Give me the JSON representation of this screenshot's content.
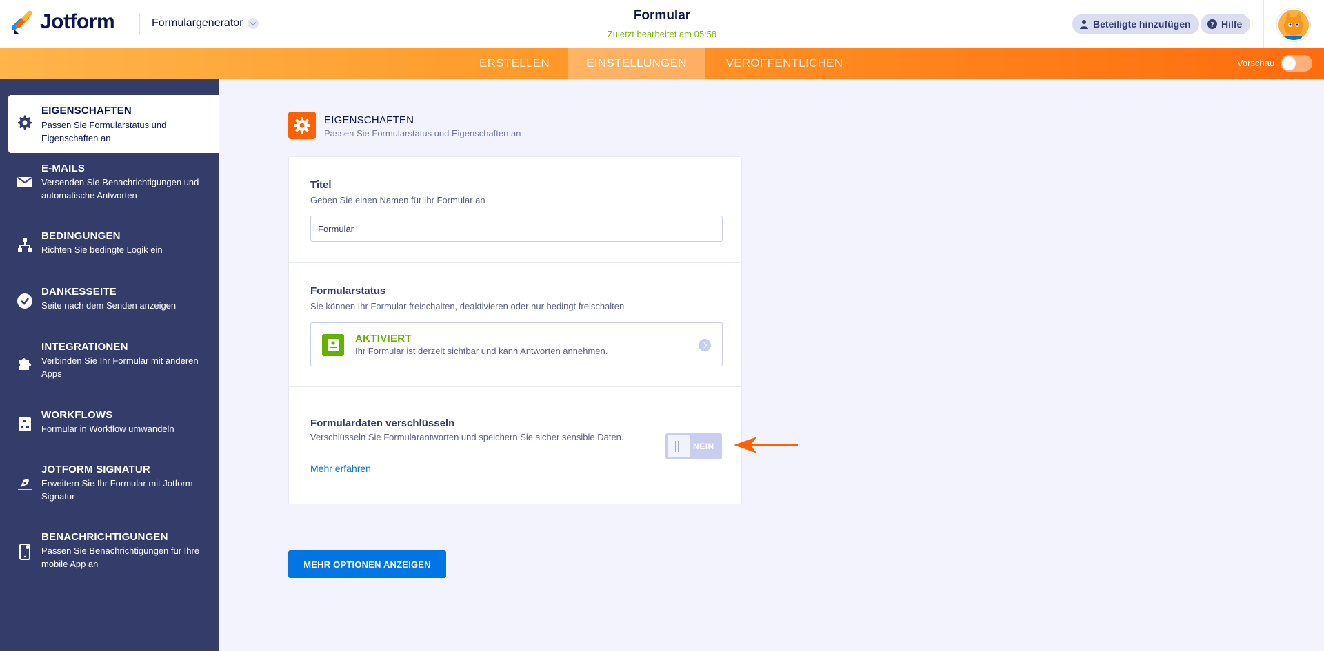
{
  "header": {
    "logo_text": "Jotform",
    "builder_label": "Formulargenerator",
    "form_title": "Formular",
    "last_edited": "Zuletzt bearbeitet am 05:58",
    "share_label": "Beteiligte hinzufügen",
    "help_label": "Hilfe"
  },
  "tabs": {
    "create": "ERSTELLEN",
    "settings": "EINSTELLUNGEN",
    "publish": "VERÖFFENTLICHEN",
    "preview_label": "Vorschau"
  },
  "sidebar": {
    "items": [
      {
        "title": "EIGENSCHAFTEN",
        "desc": "Passen Sie Formularstatus und Eigenschaften an"
      },
      {
        "title": "E-MAILS",
        "desc": "Versenden Sie Benachrichtigungen und automatische Antworten"
      },
      {
        "title": "BEDINGUNGEN",
        "desc": "Richten Sie bedingte Logik ein"
      },
      {
        "title": "DANKESSEITE",
        "desc": "Seite nach dem Senden anzeigen"
      },
      {
        "title": "INTEGRATIONEN",
        "desc": "Verbinden Sie Ihr Formular mit anderen Apps"
      },
      {
        "title": "WORKFLOWS",
        "desc": "Formular in Workflow umwandeln"
      },
      {
        "title": "JOTFORM SIGNATUR",
        "desc": "Erweitern Sie Ihr Formular mit Jotform Signatur"
      },
      {
        "title": "BENACHRICHTIGUNGEN",
        "desc": "Passen Sie Benachrichtigungen für Ihre mobile App an"
      }
    ]
  },
  "main": {
    "title": "EIGENSCHAFTEN",
    "subtitle": "Passen Sie Formularstatus und Eigenschaften an",
    "title_field": {
      "label": "Titel",
      "desc": "Geben Sie einen Namen für Ihr Formular an",
      "value": "Formular"
    },
    "status_field": {
      "label": "Formularstatus",
      "desc": "Sie können Ihr Formular freischalten, deaktivieren oder nur bedingt freischalten",
      "status_title": "AKTIVIERT",
      "status_desc": "Ihr Formular ist derzeit sichtbar und kann Antworten annehmen."
    },
    "encrypt_field": {
      "label": "Formulardaten verschlüsseln",
      "desc": "Verschlüsseln Sie Formularantworten und speichern Sie sicher sensible Daten.",
      "learn_more": "Mehr erfahren",
      "toggle_label": "NEIN"
    },
    "more_button": "MEHR OPTIONEN ANZEIGEN"
  },
  "colors": {
    "accent_orange": "#ff6100",
    "sidebar_bg": "#343c6a",
    "active_green": "#64b200",
    "primary_blue": "#0075e3"
  }
}
